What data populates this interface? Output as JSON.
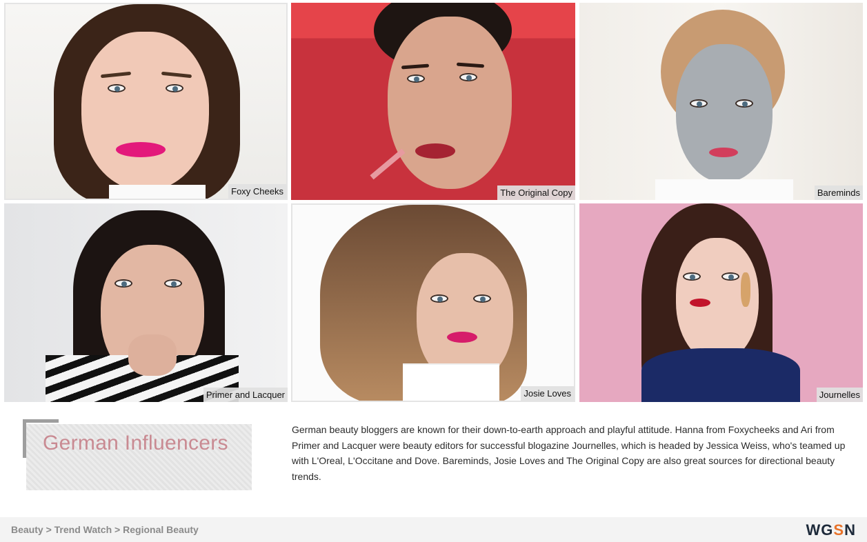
{
  "influencers": [
    {
      "name": "Foxy Cheeks"
    },
    {
      "name": "The Original Copy"
    },
    {
      "name": "Bareminds"
    },
    {
      "name": "Primer and Lacquer"
    },
    {
      "name": "Josie Loves"
    },
    {
      "name": "Journelles"
    }
  ],
  "section": {
    "title": "German Influencers",
    "body": "German beauty bloggers are known for their down-to-earth approach and playful attitude. Hanna from Foxycheeks and Ari from Primer and Lacquer were beauty editors for successful blogazine Journelles, which is headed by Jessica Weiss, who's teamed up with L'Oreal, L'Occitane and Dove. Bareminds, Josie Loves and The Original Copy are also great sources for directional beauty trends."
  },
  "breadcrumb": {
    "items": [
      "Beauty",
      "Trend Watch",
      "Regional Beauty"
    ],
    "separator": ">"
  },
  "logo": {
    "text_before": "WG",
    "text_accent": "S",
    "text_after": "N",
    "accent_color": "#e8732a"
  },
  "colors": {
    "title": "#c98a92",
    "body_text": "#2b2b2b",
    "footer_bg": "#f3f3f3"
  }
}
